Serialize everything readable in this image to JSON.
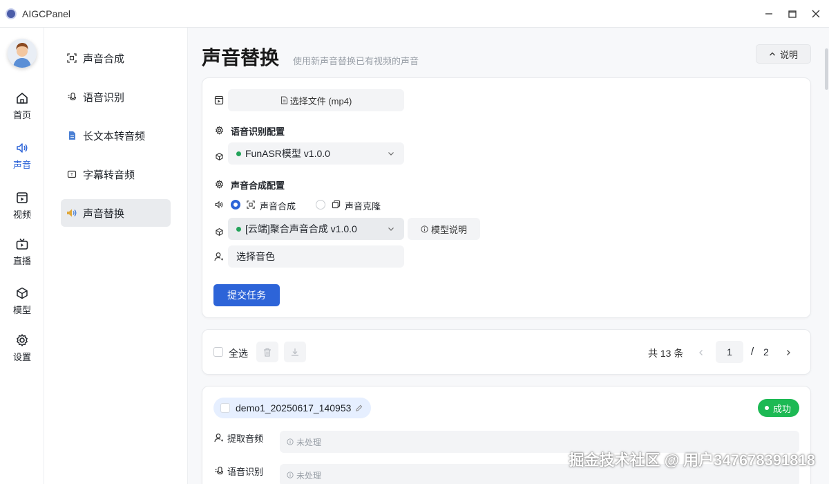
{
  "window": {
    "title": "AIGCPanel"
  },
  "rail": {
    "items": [
      {
        "label": "首页",
        "icon": "home-icon"
      },
      {
        "label": "声音",
        "icon": "speaker-icon",
        "active": true
      },
      {
        "label": "视频",
        "icon": "video-icon"
      },
      {
        "label": "直播",
        "icon": "tv-icon"
      },
      {
        "label": "模型",
        "icon": "cube-icon"
      },
      {
        "label": "设置",
        "icon": "gear-icon"
      }
    ]
  },
  "submenu": {
    "items": [
      {
        "label": "声音合成",
        "icon": "scan-icon"
      },
      {
        "label": "语音识别",
        "icon": "mic-icon"
      },
      {
        "label": "长文本转音频",
        "icon": "document-icon"
      },
      {
        "label": "字幕转音频",
        "icon": "subtitle-icon"
      },
      {
        "label": "声音替换",
        "icon": "speaker-color-icon",
        "active": true
      }
    ]
  },
  "page": {
    "title": "声音替换",
    "subtitle": "使用新声音替换已有视频的声音",
    "explain_label": "说明"
  },
  "form": {
    "file_button": "选择文件 (mp4)",
    "asr_section": "语音识别配置",
    "asr_model": "FunASR模型 v1.0.0",
    "tts_section": "声音合成配置",
    "radio_tts": "声音合成",
    "radio_clone": "声音克隆",
    "tts_model": "[云端]聚合声音合成 v1.0.0",
    "model_explain": "模型说明",
    "voice_placeholder": "选择音色",
    "submit": "提交任务"
  },
  "list_bar": {
    "select_all": "全选",
    "total": "共 13 条",
    "current_page": "1",
    "page_sep": "/",
    "total_pages": "2"
  },
  "task": {
    "name": "demo1_20250617_140953",
    "status": "成功",
    "steps": [
      {
        "label": "提取音频",
        "state": "未处理"
      },
      {
        "label": "语音识别",
        "state": "未处理"
      }
    ]
  },
  "watermark": "掘金技术社区 @ 用户347678391818",
  "colors": {
    "primary": "#2d64d8",
    "success": "#1db954",
    "active_nav": "#2d64d8"
  }
}
